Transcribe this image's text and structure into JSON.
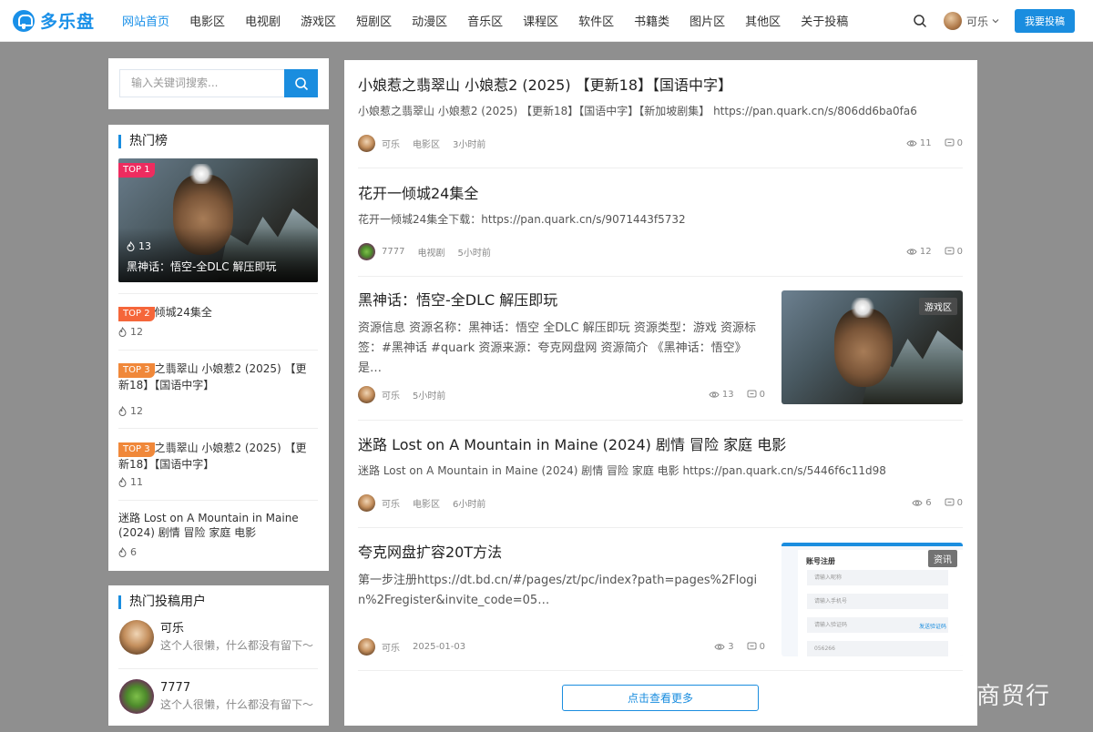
{
  "brand": {
    "name": "多乐盘"
  },
  "nav": {
    "items": [
      "网站首页",
      "电影区",
      "电视剧",
      "游戏区",
      "短剧区",
      "动漫区",
      "音乐区",
      "课程区",
      "软件区",
      "书籍类",
      "图片区",
      "其他区",
      "关于投稿"
    ],
    "active": "网站首页"
  },
  "header": {
    "user_name": "可乐",
    "submit_label": "我要投稿"
  },
  "search": {
    "placeholder": "输入关键词搜索..."
  },
  "hot": {
    "title": "热门榜",
    "cover": {
      "badge": "TOP 1",
      "heat": "13",
      "title": "黑神话：悟空-全DLC 解压即玩"
    },
    "items": [
      {
        "badge": "TOP 2",
        "title": "倾城24集全",
        "heat": "12"
      },
      {
        "badge": "TOP 3",
        "title": "之翡翠山 小娘惹2 (2025) 【更新18】【国语中字】",
        "heat": "12"
      },
      {
        "badge": "TOP 3",
        "title": "之翡翠山 小娘惹2 (2025) 【更新18】【国语中字】",
        "heat": "11"
      },
      {
        "badge": "",
        "title": "迷路 Lost on A Mountain in Maine (2024) 剧情 冒险 家庭 电影",
        "heat": "6"
      }
    ]
  },
  "hot_users": {
    "title": "热门投稿用户",
    "users": [
      {
        "name": "可乐",
        "signature": "这个人很懒，什么都没有留下～"
      },
      {
        "name": "7777",
        "signature": "这个人很懒，什么都没有留下～"
      }
    ]
  },
  "posts": [
    {
      "title": "小娘惹之翡翠山 小娘惹2 (2025) 【更新18】【国语中字】",
      "excerpt": "小娘惹之翡翠山 小娘惹2 (2025) 【更新18】【国语中字】【新加坡剧集】 https://pan.quark.cn/s/806dd6ba0fa6",
      "author": "可乐",
      "category": "电影区",
      "time": "3小时前",
      "views": "11",
      "comments": "0"
    },
    {
      "title": "花开一倾城24集全",
      "excerpt": "花开一倾城24集全下载：https://pan.quark.cn/s/9071443f5732",
      "author": "7777",
      "category": "电视剧",
      "time": "5小时前",
      "views": "12",
      "comments": "0"
    },
    {
      "title": "黑神话：悟空-全DLC 解压即玩",
      "excerpt": "资源信息 资源名称：黑神话：悟空 全DLC 解压即玩 资源类型：游戏 资源标签：#黑神话 #quark 资源来源：夸克网盘网 资源简介 《黑神话：悟空》是…",
      "author": "可乐",
      "category": "",
      "time": "5小时前",
      "views": "13",
      "comments": "0",
      "tag": "游戏区"
    },
    {
      "title": "迷路 Lost on A Mountain in Maine (2024) 剧情 冒险 家庭 电影",
      "excerpt": "迷路 Lost on A Mountain in Maine (2024) 剧情 冒险 家庭 电影 https://pan.quark.cn/s/5446f6c11d98",
      "author": "可乐",
      "category": "电影区",
      "time": "6小时前",
      "views": "6",
      "comments": "0"
    },
    {
      "title": "夸克网盘扩容20T方法",
      "excerpt": "第一步注册https://dt.bd.cn/#/pages/zt/pc/index?path=pages%2Flogin%2Fregister&invite_code=05…",
      "author": "可乐",
      "category": "",
      "time": "2025-01-03",
      "views": "3",
      "comments": "0",
      "tag": "资讯",
      "form": {
        "title": "账号注册",
        "fields": [
          "请输入昵称",
          "请输入手机号",
          "请输入验证码",
          "056266"
        ],
        "link": "发送验证码"
      }
    }
  ],
  "more_label": "点击查看更多",
  "watermark": {
    "text": "@酷栗商贸行",
    "paw": "du"
  },
  "colors": {
    "accent": "#1a8ddf",
    "top1": "#ee2c5f",
    "top2": "#f5663a",
    "top3": "#f0883a"
  }
}
